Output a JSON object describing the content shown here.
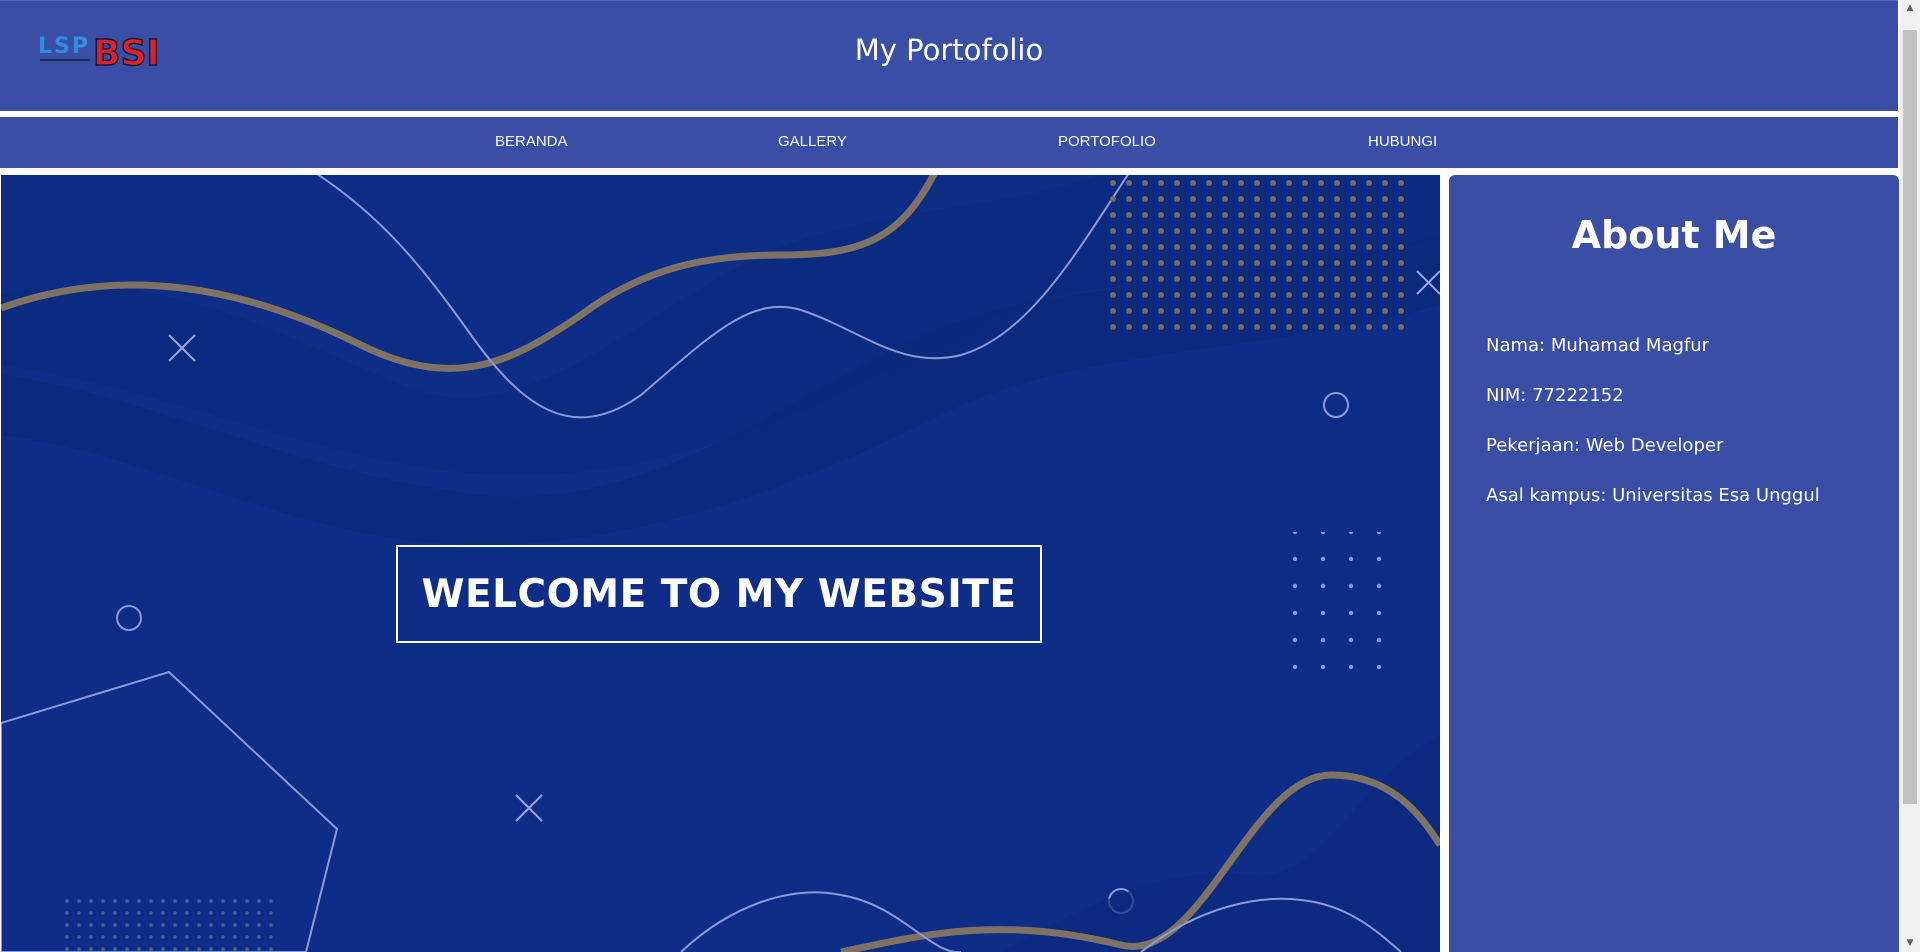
{
  "header": {
    "logo_text_lsp": "LSP",
    "logo_text_bsi": "BSI",
    "title": "My Portofolio"
  },
  "nav": {
    "items": [
      {
        "label": "BERANDA"
      },
      {
        "label": "GALLERY"
      },
      {
        "label": "PORTOFOLIO"
      },
      {
        "label": "HUBUNGI"
      }
    ]
  },
  "hero": {
    "welcome": "WELCOME TO MY WEBSITE"
  },
  "about": {
    "title": "About Me",
    "rows": [
      {
        "text": "Nama: Muhamad Magfur"
      },
      {
        "text": "NIM: 77222152"
      },
      {
        "text": "Pekerjaan: Web Developer"
      },
      {
        "text": "Asal kampus: Universitas Esa Unggul"
      }
    ]
  },
  "colors": {
    "header_bg": "#3a4ea5",
    "hero_bg": "#0d2d86",
    "wave_gold": "#7e7264",
    "line_light": "#8c9ad6"
  },
  "icons": {
    "scroll_up": "triangle-up-icon",
    "scroll_down": "triangle-down-icon"
  }
}
